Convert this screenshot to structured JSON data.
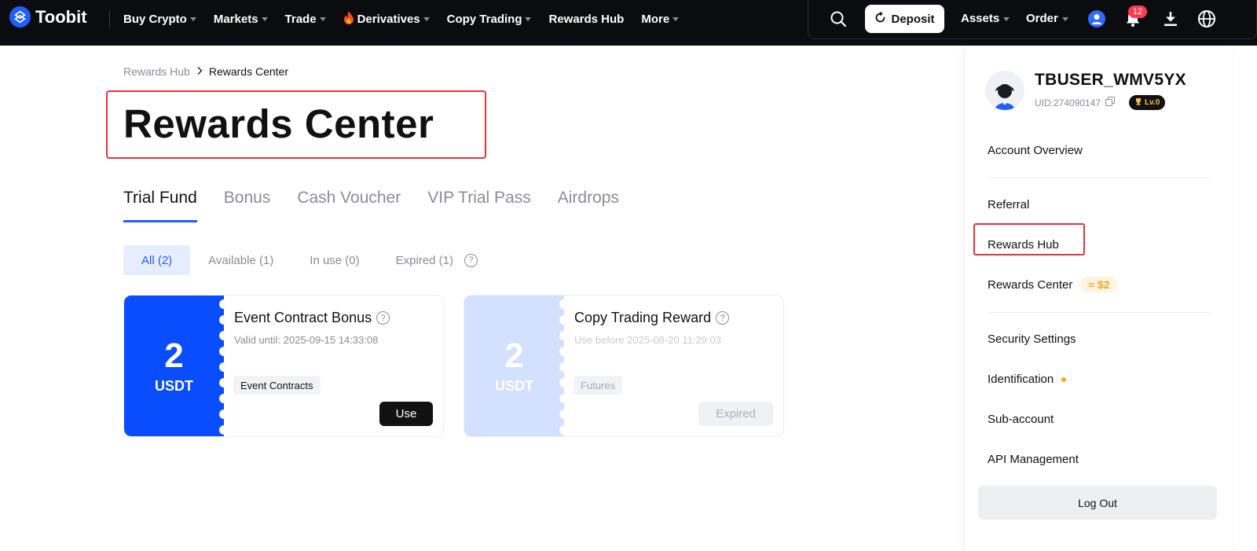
{
  "header": {
    "logo_text": "Toobit",
    "nav": [
      {
        "label": "Buy Crypto",
        "caret": true
      },
      {
        "label": "Markets",
        "caret": true
      },
      {
        "label": "Trade",
        "caret": true
      },
      {
        "label": "Derivatives",
        "caret": true,
        "icon": "fire-icon"
      },
      {
        "label": "Copy Trading",
        "caret": true
      },
      {
        "label": "Rewards Hub",
        "caret": false
      },
      {
        "label": "More",
        "caret": true
      }
    ],
    "deposit_label": "Deposit",
    "assets_label": "Assets",
    "order_label": "Order",
    "notification_count": "12"
  },
  "breadcrumb": {
    "parent": "Rewards Hub",
    "current": "Rewards Center"
  },
  "page_title": "Rewards Center",
  "tabs": [
    "Trial Fund",
    "Bonus",
    "Cash Voucher",
    "VIP Trial Pass",
    "Airdrops"
  ],
  "active_tab": "Trial Fund",
  "filters": [
    "All (2)",
    "Available (1)",
    "In use (0)",
    "Expired (1)"
  ],
  "cards": [
    {
      "amount": "2",
      "currency": "USDT",
      "name": "Event Contract Bonus",
      "valid": "Valid until: 2025-09-15 14:33:08",
      "tag": "Event Contracts",
      "action": "Use",
      "color": "#0a4dff"
    },
    {
      "amount": "2",
      "currency": "USDT",
      "name": "Copy Trading Reward",
      "valid": "Use before 2025-08-20 11:29:03",
      "tag": "Futures",
      "action": "Expired",
      "color": "#d4e0ff"
    }
  ],
  "account": {
    "username": "TBUSER_WMV5YX",
    "uid": "UID:274090147",
    "level": "Lv.0",
    "menu": {
      "overview": "Account Overview",
      "referral": "Referral",
      "rewards_hub": "Rewards Hub",
      "rewards_center": "Rewards Center",
      "rewards_amount": "≈ $2",
      "security": "Security Settings",
      "identification": "Identification",
      "sub_account": "Sub-account",
      "api": "API Management"
    },
    "logout": "Log Out"
  }
}
